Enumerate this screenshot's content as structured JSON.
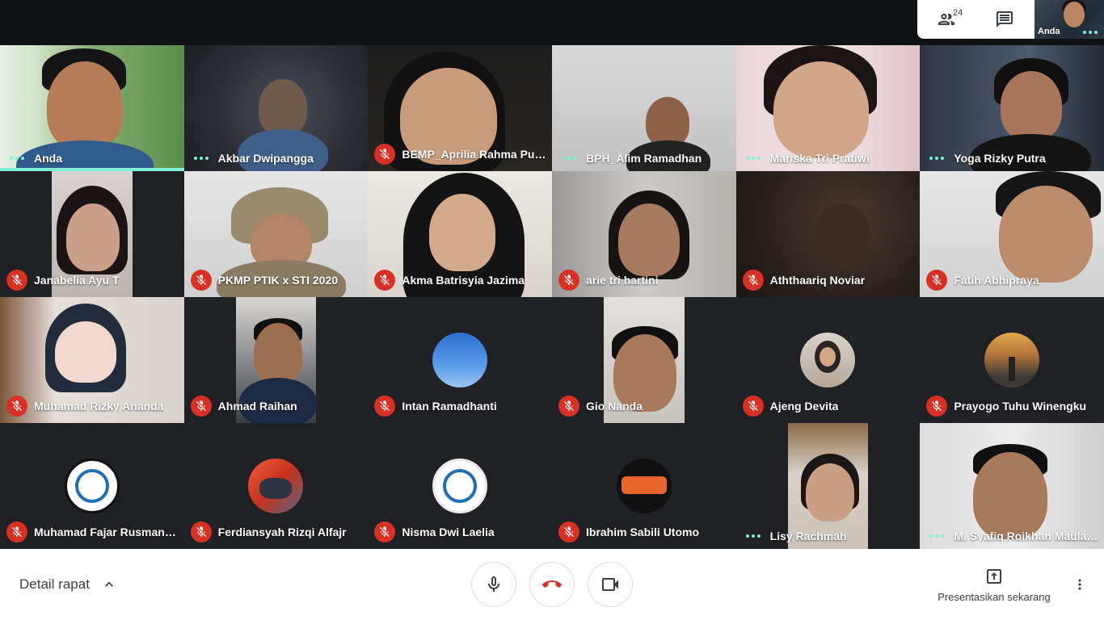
{
  "topbar": {
    "people_count": "24",
    "self_label": "Anda"
  },
  "participants": [
    {
      "name": "Anda",
      "status": "speaking"
    },
    {
      "name": "Akbar Dwipangga",
      "status": "dots"
    },
    {
      "name": "BEMP_Aprilia Rahma Pusp...",
      "status": "muted"
    },
    {
      "name": "BPH_Alim Ramadhan",
      "status": "dots"
    },
    {
      "name": "Mariska Tri Pratiwi",
      "status": "dots"
    },
    {
      "name": "Yoga Rizky Putra",
      "status": "dots"
    },
    {
      "name": "Janabelia Ayu T",
      "status": "muted"
    },
    {
      "name": "PKMP PTIK x STI 2020",
      "status": "muted"
    },
    {
      "name": "Akma Batrisyia Jazima",
      "status": "muted"
    },
    {
      "name": "arie tri hartini",
      "status": "muted"
    },
    {
      "name": "Aththaariq Noviar",
      "status": "muted"
    },
    {
      "name": "Fatih Abhipraya",
      "status": "muted"
    },
    {
      "name": "Muhamad Rizky Ananda",
      "status": "muted"
    },
    {
      "name": "Ahmad Raihan",
      "status": "muted"
    },
    {
      "name": "Intan Ramadhanti",
      "status": "muted"
    },
    {
      "name": "Gio Nanda",
      "status": "muted"
    },
    {
      "name": "Ajeng Devita",
      "status": "muted"
    },
    {
      "name": "Prayogo Tuhu Winengku",
      "status": "muted"
    },
    {
      "name": "Muhamad Fajar Rusmanha...",
      "status": "muted"
    },
    {
      "name": "Ferdiansyah Rizqi Alfajr",
      "status": "muted"
    },
    {
      "name": "Nisma Dwi Laelia",
      "status": "muted"
    },
    {
      "name": "Ibrahim Sabili Utomo",
      "status": "muted"
    },
    {
      "name": "Lisy Rachmah",
      "status": "dots"
    },
    {
      "name": "M. Syafiq Roikhan Maulana",
      "status": "dots"
    }
  ],
  "bottombar": {
    "details_label": "Detail rapat",
    "present_label": "Presentasikan sekarang"
  },
  "icons": {
    "people": "people-icon",
    "chat": "chat-icon",
    "mic": "mic-icon",
    "hangup": "hangup-icon",
    "camera": "camera-icon",
    "present": "present-icon",
    "more": "more-vert-icon",
    "chevron": "chevron-up-icon"
  },
  "colors": {
    "accent": "#7cf3d6",
    "muted": "#d93025",
    "background": "#202124"
  }
}
